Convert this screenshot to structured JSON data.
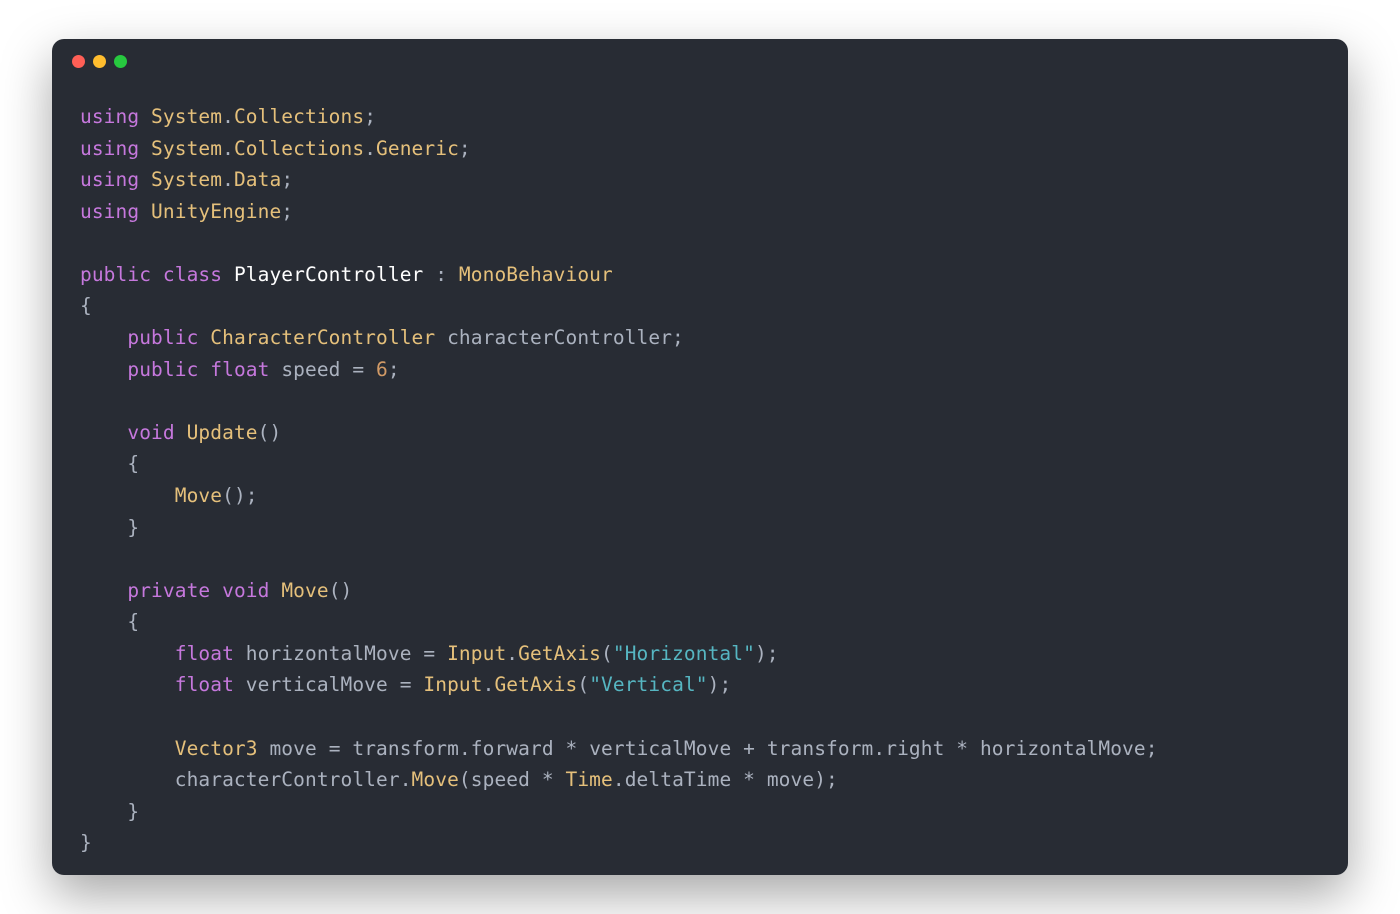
{
  "window": {
    "dots": {
      "red": "#ff5f56",
      "yellow": "#ffbd2e",
      "green": "#27c93f"
    }
  },
  "code": {
    "t_using": "using",
    "t_public": "public",
    "t_class": "class",
    "t_void": "void",
    "t_float": "float",
    "t_private": "private",
    "ns_System": "System",
    "ns_Collections": "Collections",
    "ns_Generic": "Generic",
    "ns_Data": "Data",
    "ns_UnityEngine": "UnityEngine",
    "className": "PlayerController",
    "baseClass": "MonoBehaviour",
    "type_CharacterController": "CharacterController",
    "field_characterController": "characterController",
    "field_speed": "speed",
    "num_six": "6",
    "fn_Update": "Update",
    "fn_Move": "Move",
    "var_horizontalMove": "horizontalMove",
    "var_verticalMove": "verticalMove",
    "cls_Input": "Input",
    "fn_GetAxis": "GetAxis",
    "str_Horizontal": "\"Horizontal\"",
    "str_Vertical": "\"Vertical\"",
    "cls_Vector3": "Vector3",
    "var_move": "move",
    "id_transform": "transform",
    "id_forward": "forward",
    "id_right": "right",
    "cls_Time": "Time",
    "id_deltaTime": "deltaTime",
    "p_dot": ".",
    "p_semi": ";",
    "p_colon": ":",
    "p_eq": "=",
    "p_star": "*",
    "p_plus": "+",
    "p_lparen": "(",
    "p_rparen": ")",
    "p_lbrace": "{",
    "p_rbrace": "}"
  }
}
